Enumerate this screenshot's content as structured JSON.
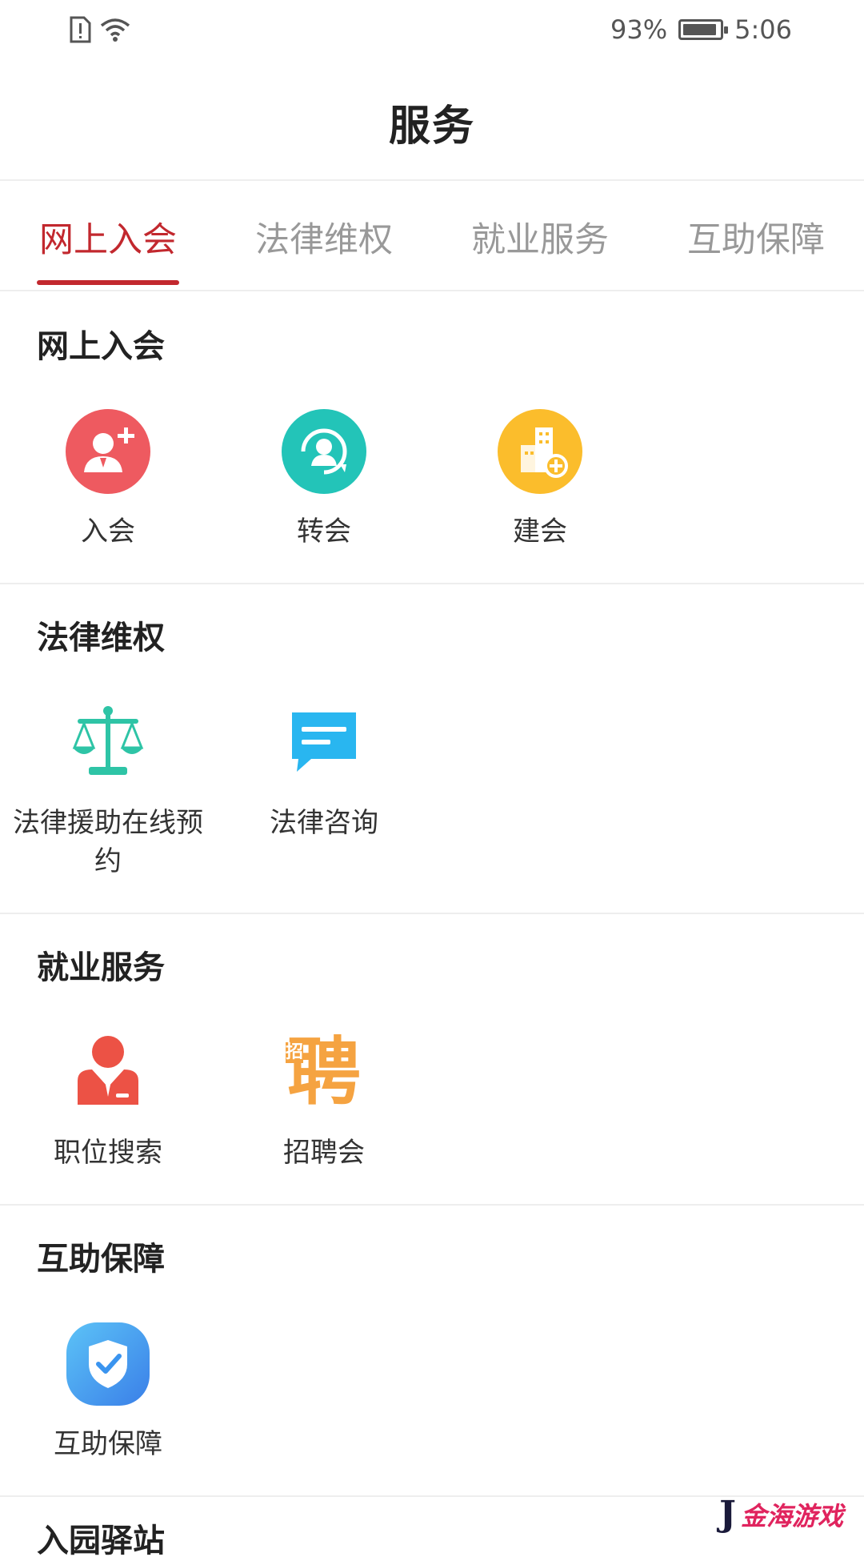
{
  "status_bar": {
    "battery_percent": "93%",
    "battery_level": 0.93,
    "time": "5:06"
  },
  "header": {
    "title": "服务"
  },
  "tabs": [
    {
      "label": "网上入会",
      "active": true
    },
    {
      "label": "法律维权",
      "active": false
    },
    {
      "label": "就业服务",
      "active": false
    },
    {
      "label": "互助保障",
      "active": false
    }
  ],
  "sections": [
    {
      "title": "网上入会",
      "items": [
        {
          "label": "入会",
          "icon": "add-user-icon",
          "color": "#ee5a60"
        },
        {
          "label": "转会",
          "icon": "transfer-user-icon",
          "color": "#23c4b8"
        },
        {
          "label": "建会",
          "icon": "building-add-icon",
          "color": "#fbbd2c"
        }
      ]
    },
    {
      "title": "法律维权",
      "items": [
        {
          "label": "法律援助在线预约",
          "icon": "scales-icon",
          "color": "#2ec4a6"
        },
        {
          "label": "法律咨询",
          "icon": "chat-bubble-icon",
          "color": "#29b6f0"
        }
      ]
    },
    {
      "title": "就业服务",
      "items": [
        {
          "label": "职位搜索",
          "icon": "person-suit-icon",
          "color": "#ec5245"
        },
        {
          "label": "招聘会",
          "icon": "recruit-character-icon",
          "color": "#f5a341",
          "glyph": "聘",
          "small_glyph": "招"
        }
      ]
    },
    {
      "title": "互助保障",
      "items": [
        {
          "label": "互助保障",
          "icon": "shield-check-icon",
          "color": "#3a94ef"
        }
      ]
    }
  ],
  "peek_section": {
    "title": "入园驿站"
  },
  "watermark": {
    "letter": "J",
    "text": "金海游戏"
  }
}
